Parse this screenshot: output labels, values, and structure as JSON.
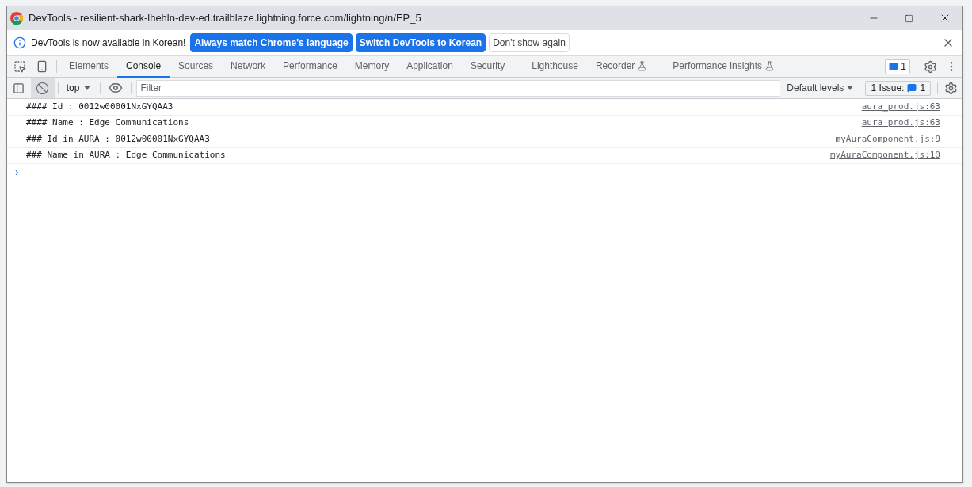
{
  "window": {
    "title": "DevTools - resilient-shark-lhehln-dev-ed.trailblaze.lightning.force.com/lightning/n/EP_5"
  },
  "infobar": {
    "message": "DevTools is now available in Korean!",
    "buttons": [
      {
        "label": "Always match Chrome's language",
        "kind": "primary"
      },
      {
        "label": "Switch DevTools to Korean",
        "kind": "primary"
      },
      {
        "label": "Don't show again",
        "kind": "secondary"
      }
    ]
  },
  "tabs": [
    {
      "label": "Elements",
      "selected": false,
      "experimental": false
    },
    {
      "label": "Console",
      "selected": true,
      "experimental": false
    },
    {
      "label": "Sources",
      "selected": false,
      "experimental": false
    },
    {
      "label": "Network",
      "selected": false,
      "experimental": false
    },
    {
      "label": "Performance",
      "selected": false,
      "experimental": false
    },
    {
      "label": "Memory",
      "selected": false,
      "experimental": false
    },
    {
      "label": "Application",
      "selected": false,
      "experimental": false
    },
    {
      "label": "Security",
      "selected": false,
      "experimental": false
    },
    {
      "label": "Lighthouse",
      "selected": false,
      "experimental": false
    },
    {
      "label": "Recorder",
      "selected": false,
      "experimental": true
    },
    {
      "label": "Performance insights",
      "selected": false,
      "experimental": true
    }
  ],
  "issues_badge": "1",
  "console_toolbar": {
    "context": "top",
    "filter_placeholder": "Filter",
    "levels": "Default levels",
    "issues_label": "1 Issue:",
    "issues_count": "1"
  },
  "messages": [
    {
      "text": "#### Id : 0012w00001NxGYQAA3",
      "source": "aura_prod.js:63"
    },
    {
      "text": "#### Name : Edge Communications",
      "source": "aura_prod.js:63"
    },
    {
      "text": "### Id in AURA : 0012w00001NxGYQAA3",
      "source": "myAuraComponent.js:9"
    },
    {
      "text": "### Name in AURA : Edge Communications",
      "source": "myAuraComponent.js:10"
    }
  ],
  "prompt": "›"
}
